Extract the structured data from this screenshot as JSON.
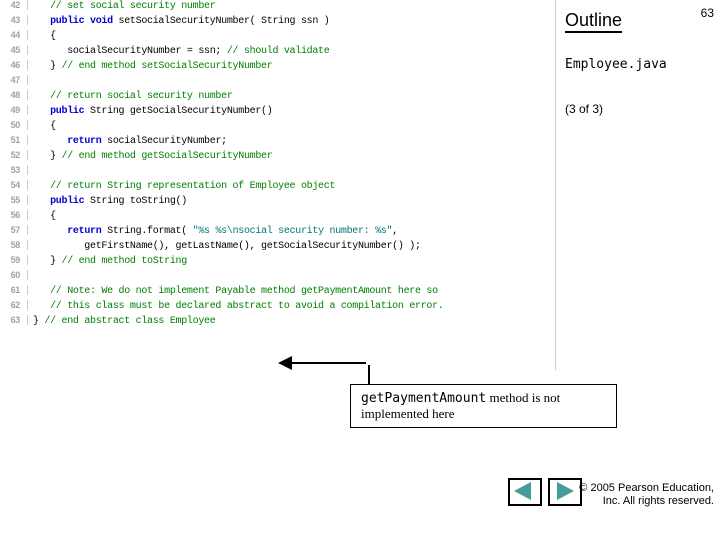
{
  "slide_number": "63",
  "outline_heading": "Outline",
  "filename": "Employee.java",
  "part_indicator": "(3 of 3)",
  "callout": {
    "code": "getPaymentAmount",
    "text": " method is not implemented here"
  },
  "copyright": {
    "line1": "© 2005 Pearson Education,",
    "line2": "Inc. All rights reserved."
  },
  "code": [
    {
      "n": "42",
      "seg": [
        {
          "c": "cmt",
          "t": "   // set social security number"
        }
      ]
    },
    {
      "n": "43",
      "seg": [
        {
          "c": "plain",
          "t": "   "
        },
        {
          "c": "kw",
          "t": "public void"
        },
        {
          "c": "plain",
          "t": " setSocialSecurityNumber( String ssn )"
        }
      ]
    },
    {
      "n": "44",
      "seg": [
        {
          "c": "plain",
          "t": "   {"
        }
      ]
    },
    {
      "n": "45",
      "seg": [
        {
          "c": "plain",
          "t": "      socialSecurityNumber = ssn; "
        },
        {
          "c": "cmt",
          "t": "// should validate"
        }
      ]
    },
    {
      "n": "46",
      "seg": [
        {
          "c": "plain",
          "t": "   } "
        },
        {
          "c": "cmt",
          "t": "// end method setSocialSecurityNumber"
        }
      ]
    },
    {
      "n": "47",
      "seg": [
        {
          "c": "plain",
          "t": " "
        }
      ]
    },
    {
      "n": "48",
      "seg": [
        {
          "c": "cmt",
          "t": "   // return social security number"
        }
      ]
    },
    {
      "n": "49",
      "seg": [
        {
          "c": "plain",
          "t": "   "
        },
        {
          "c": "kw",
          "t": "public"
        },
        {
          "c": "plain",
          "t": " String getSocialSecurityNumber()"
        }
      ]
    },
    {
      "n": "50",
      "seg": [
        {
          "c": "plain",
          "t": "   {"
        }
      ]
    },
    {
      "n": "51",
      "seg": [
        {
          "c": "plain",
          "t": "      "
        },
        {
          "c": "kw",
          "t": "return"
        },
        {
          "c": "plain",
          "t": " socialSecurityNumber;"
        }
      ]
    },
    {
      "n": "52",
      "seg": [
        {
          "c": "plain",
          "t": "   } "
        },
        {
          "c": "cmt",
          "t": "// end method getSocialSecurityNumber"
        }
      ]
    },
    {
      "n": "53",
      "seg": [
        {
          "c": "plain",
          "t": " "
        }
      ]
    },
    {
      "n": "54",
      "seg": [
        {
          "c": "cmt",
          "t": "   // return String representation of Employee object"
        }
      ]
    },
    {
      "n": "55",
      "seg": [
        {
          "c": "plain",
          "t": "   "
        },
        {
          "c": "kw",
          "t": "public"
        },
        {
          "c": "plain",
          "t": " String toString()"
        }
      ]
    },
    {
      "n": "56",
      "seg": [
        {
          "c": "plain",
          "t": "   {"
        }
      ]
    },
    {
      "n": "57",
      "seg": [
        {
          "c": "plain",
          "t": "      "
        },
        {
          "c": "kw",
          "t": "return"
        },
        {
          "c": "plain",
          "t": " String.format( "
        },
        {
          "c": "lit",
          "t": "\"%s %s\\nsocial security number: %s\""
        },
        {
          "c": "plain",
          "t": ","
        }
      ]
    },
    {
      "n": "58",
      "seg": [
        {
          "c": "plain",
          "t": "         getFirstName(), getLastName(), getSocialSecurityNumber() );"
        }
      ]
    },
    {
      "n": "59",
      "seg": [
        {
          "c": "plain",
          "t": "   } "
        },
        {
          "c": "cmt",
          "t": "// end method toString"
        }
      ]
    },
    {
      "n": "60",
      "seg": [
        {
          "c": "plain",
          "t": " "
        }
      ]
    },
    {
      "n": "61",
      "seg": [
        {
          "c": "cmt",
          "t": "   // Note: We do not implement Payable method getPaymentAmount here so "
        }
      ]
    },
    {
      "n": "62",
      "seg": [
        {
          "c": "cmt",
          "t": "   // this class must be declared abstract to avoid a compilation error."
        }
      ]
    },
    {
      "n": "63",
      "seg": [
        {
          "c": "plain",
          "t": "} "
        },
        {
          "c": "cmt",
          "t": "// end abstract class Employee"
        }
      ]
    }
  ]
}
